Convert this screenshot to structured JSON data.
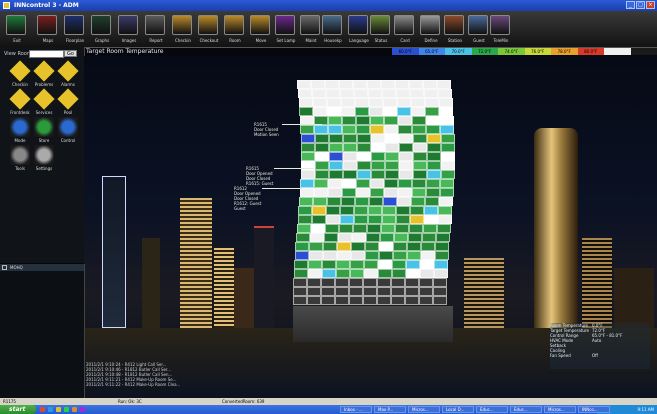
{
  "window": {
    "title": "INNcontrol 3 - ADM"
  },
  "toolbar": [
    {
      "label": "Exit",
      "color": "#1f7a3a",
      "name": "exit"
    },
    {
      "label": "Maps",
      "color": "#7a1f1f",
      "name": "maps"
    },
    {
      "label": "Floorplan",
      "color": "#1f2f6a",
      "name": "floorplan"
    },
    {
      "label": "Graphs",
      "color": "#1f3f2f",
      "name": "graphs"
    },
    {
      "label": "Images",
      "color": "#3a3a6a",
      "name": "images"
    },
    {
      "label": "Report",
      "color": "#5a5a5a",
      "name": "report"
    },
    {
      "label": "Checkin",
      "color": "#b98a2a",
      "name": "checkin"
    },
    {
      "label": "Checkout",
      "color": "#b98a2a",
      "name": "checkout"
    },
    {
      "label": "Room",
      "color": "#b98a2a",
      "name": "room"
    },
    {
      "label": "Move",
      "color": "#b98a2a",
      "name": "move"
    },
    {
      "label": "Set Lamp",
      "color": "#6a2a8a",
      "name": "set-lamp"
    },
    {
      "label": "Maint",
      "color": "#6a6a6a",
      "name": "maint"
    },
    {
      "label": "Housekp",
      "color": "#4a6a8a",
      "name": "housekp"
    },
    {
      "label": "Language",
      "color": "#2a3a8a",
      "name": "language"
    },
    {
      "label": "Status",
      "color": "#6a8a3a",
      "name": "status"
    },
    {
      "label": "Card",
      "color": "#8a8a8a",
      "name": "card"
    },
    {
      "label": "Define",
      "color": "#9a9a9a",
      "name": "define"
    },
    {
      "label": "Station",
      "color": "#8a4a2a",
      "name": "station"
    },
    {
      "label": "Guest",
      "color": "#4a6a9a",
      "name": "guest"
    },
    {
      "label": "TeleMin",
      "color": "#6a4a7a",
      "name": "telemin"
    }
  ],
  "colorbar": [
    {
      "label": "60.0°F",
      "color": "#2a4fd0"
    },
    {
      "label": "65.0°F",
      "color": "#3f86e8"
    },
    {
      "label": "70.0°F",
      "color": "#49c2e6"
    },
    {
      "label": "72.0°F",
      "color": "#2aa84a"
    },
    {
      "label": "74.0°F",
      "color": "#7ac83a"
    },
    {
      "label": "76.0°F",
      "color": "#c8d83a"
    },
    {
      "label": "78.0°F",
      "color": "#e8a02a"
    },
    {
      "label": "80.0°F",
      "color": "#d83a2a"
    },
    {
      "label": "",
      "color": "#f0f0f0"
    },
    {
      "label": "",
      "color": "#1a1a1a"
    }
  ],
  "sidebar": {
    "view_room_label": "View Room:",
    "go_label": "Go",
    "items": [
      {
        "label": "Checkin",
        "color": "#e8c22a",
        "name": "checkin"
      },
      {
        "label": "Problems",
        "color": "#e8c22a",
        "name": "problems"
      },
      {
        "label": "Alarms",
        "color": "#e8c22a",
        "name": "alarms"
      },
      {
        "label": "Frontdesk",
        "color": "#e8c22a",
        "name": "frontdesk"
      },
      {
        "label": "Services",
        "color": "#e8c22a",
        "name": "services"
      },
      {
        "label": "Pool",
        "color": "#e8c22a",
        "name": "pool"
      },
      {
        "label": "Mode",
        "color": "#2a6ad0",
        "name": "mode"
      },
      {
        "label": "Store",
        "color": "#2a9a3a",
        "name": "store"
      },
      {
        "label": "Control",
        "color": "#2a6ad0",
        "name": "control"
      },
      {
        "label": "Tools",
        "color": "#888888",
        "name": "tools"
      },
      {
        "label": "Settings",
        "color": "#aaaaaa",
        "name": "settings"
      }
    ]
  },
  "map": {
    "title": "Target Room Temperature"
  },
  "callouts": [
    {
      "lines": [
        "R1615",
        "Door Closed",
        "Motion Seen"
      ]
    },
    {
      "lines": [
        "R1615",
        "Door Opened",
        "Door Closed",
        "R1615: Guest"
      ]
    },
    {
      "lines": [
        "R1612",
        "Door Opened",
        "Door Closed",
        "R1612: Guest",
        "Guest"
      ]
    }
  ],
  "left_panel": {
    "header": "MOHQ"
  },
  "log": [
    "2011/2/1 9:10:24 - R412 Light Call Ser...",
    "2011/2/1 9:10:46 - R1812 Butler Call Ser...",
    "2011/2/1 9:10:48 - R1812 Butler Call Sen...",
    "2011/2/1 9:11:21 - R412 Make-Up Room Se...",
    "2011/2/1 9:11:22 - R412 Make-Up Room Clea..."
  ],
  "info": [
    {
      "k": "Room Temperature",
      "v": "0.0°F"
    },
    {
      "k": "Target Temperature",
      "v": "72.0°F"
    },
    {
      "k": "Control Range",
      "v": "65.0°F - 81.0°F"
    },
    {
      "k": "HVAC Mode",
      "v": "Auto"
    },
    {
      "k": "Setback",
      "v": ""
    },
    {
      "k": "Cooling",
      "v": ""
    },
    {
      "k": "Fan Speed",
      "v": "Off"
    }
  ],
  "status": {
    "left": "R1175",
    "mid": "Run: Ok: 3C",
    "right": "ConvertedRoom: 639"
  },
  "taskbar": {
    "start": "start",
    "tasks": [
      "Inbox - ...",
      "Max P...",
      "Micros...",
      "Local D...",
      "Educ...",
      "Educ...",
      "Micros...",
      "INNco..."
    ],
    "clock": "9:11 AM"
  }
}
